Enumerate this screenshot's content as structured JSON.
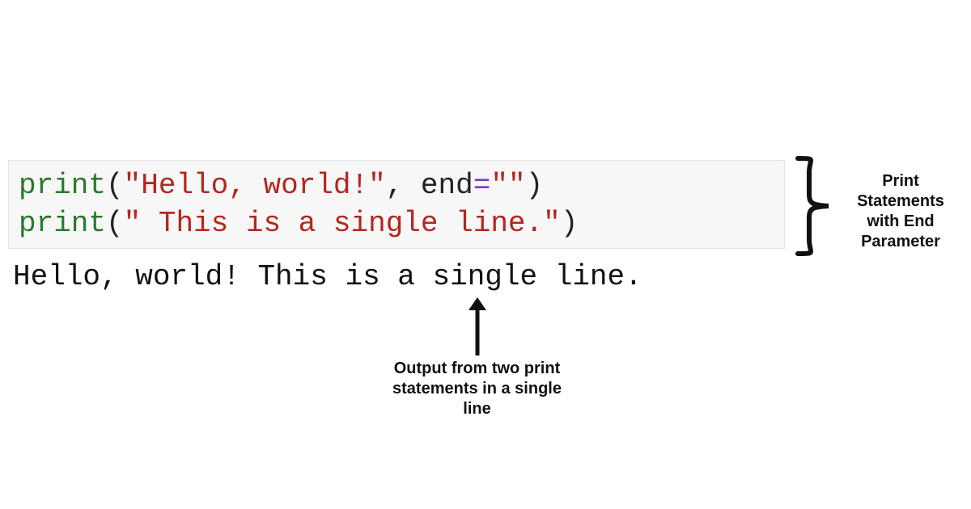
{
  "code": {
    "line1": {
      "func": "print",
      "open": "(",
      "str": "\"Hello, world!\"",
      "comma": ", ",
      "kwarg": "end",
      "eq": "=",
      "val": "\"\"",
      "close": ")"
    },
    "line2": {
      "func": "print",
      "open": "(",
      "str": "\" This is a single line.\"",
      "close": ")"
    }
  },
  "output": "Hello, world! This is a single line.",
  "annotations": {
    "right": "Print Statements with End Parameter",
    "bottom": "Output from two print statements in a single line"
  },
  "colors": {
    "func": "#2a7a2a",
    "string": "#b3261e",
    "equals": "#7a3db8",
    "code_bg": "#f7f7f7",
    "code_border": "#e3e3e3",
    "text": "#111111"
  }
}
